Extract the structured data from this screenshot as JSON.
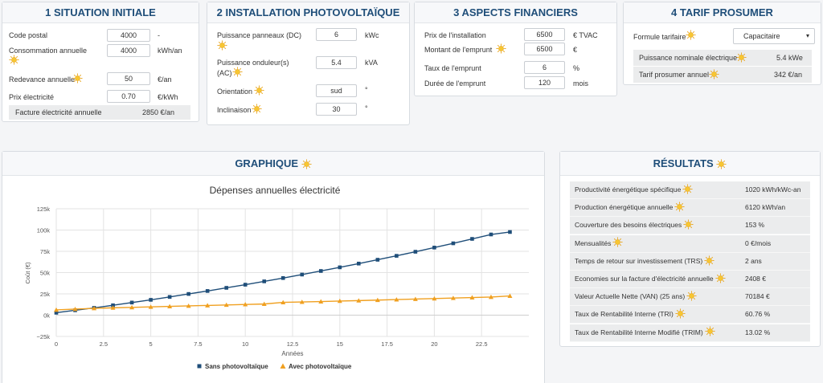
{
  "situation": {
    "title": "1 SITUATION INITIALE",
    "postal_label": "Code postal",
    "postal_value": "4000",
    "postal_unit": "-",
    "consumption_label": "Consommation annuelle",
    "consumption_value": "4000",
    "consumption_unit": "kWh/an",
    "fee_label": "Redevance annuelle",
    "fee_value": "50",
    "fee_unit": "€/an",
    "price_label": "Prix électricité",
    "price_value": "0.70",
    "price_unit": "€/kWh",
    "bill_label": "Facture électricité annuelle",
    "bill_value": "2850 €/an"
  },
  "installation": {
    "title": "2 INSTALLATION PHOTOVOLTAÏQUE",
    "panel_power_label": "Puissance panneaux (DC)",
    "panel_power_value": "6",
    "panel_power_unit": "kWc",
    "inverter_label_1": "Puissance onduleur(s)",
    "inverter_label_2": "(AC)",
    "inverter_value": "5.4",
    "inverter_unit": "kVA",
    "orientation_label": "Orientation",
    "orientation_value": "sud",
    "orientation_unit": "°",
    "tilt_label": "Inclinaison",
    "tilt_value": "30",
    "tilt_unit": "°"
  },
  "financial": {
    "title": "3 ASPECTS FINANCIERS",
    "install_price_label": "Prix de l'installation",
    "install_price_value": "6500",
    "install_price_unit": "€ TVAC",
    "loan_amount_label": "Montant de l'emprunt",
    "loan_amount_value": "6500",
    "loan_amount_unit": "€",
    "loan_rate_label": "Taux de l'emprunt",
    "loan_rate_value": "6",
    "loan_rate_unit": "%",
    "loan_duration_label": "Durée de l'emprunt",
    "loan_duration_value": "120",
    "loan_duration_unit": "mois"
  },
  "prosumer": {
    "title": "4 TARIF PROSUMER",
    "formula_label": "Formule tarifaire",
    "formula_value": "Capacitaire",
    "nominal_label": "Puissance nominale électrique",
    "nominal_value": "5.4 kWe",
    "tariff_label": "Tarif prosumer annuel",
    "tariff_value": "342 €/an"
  },
  "graph": {
    "panel_title": "GRAPHIQUE"
  },
  "chart_data": {
    "type": "line",
    "title": "Dépenses annuelles électricité",
    "xlabel": "Années",
    "ylabel": "Coût (€)",
    "xlim": [
      0,
      25
    ],
    "ylim": [
      -25000,
      125000
    ],
    "x_ticks": [
      "0",
      "2.5",
      "5",
      "7.5",
      "10",
      "12.5",
      "15",
      "17.5",
      "20",
      "22.5"
    ],
    "y_ticks": [
      "125k",
      "100k",
      "75k",
      "50k",
      "25k",
      "0k",
      "−25k"
    ],
    "grid": true,
    "legend": "bottom",
    "x": [
      0,
      1,
      2,
      3,
      4,
      5,
      6,
      7,
      8,
      9,
      10,
      11,
      12,
      13,
      14,
      15,
      16,
      17,
      18,
      19,
      20,
      21,
      22,
      23,
      24
    ],
    "series": [
      {
        "name": "Sans photovoltaïque",
        "color": "#1f4e79",
        "marker": "square",
        "values": [
          2850,
          5700,
          8600,
          11600,
          14800,
          18000,
          21400,
          24900,
          28400,
          32100,
          35800,
          39700,
          43600,
          47700,
          51900,
          56200,
          60600,
          65100,
          69700,
          74500,
          79400,
          84400,
          89600,
          94800,
          97700
        ]
      },
      {
        "name": "Avec photovoltaïque",
        "color": "#f0a020",
        "marker": "triangle",
        "values": [
          6200,
          7100,
          8000,
          8600,
          9100,
          9700,
          10300,
          10900,
          11400,
          12000,
          12600,
          13100,
          15000,
          15500,
          16000,
          16600,
          17100,
          17700,
          18300,
          18900,
          19500,
          20100,
          20700,
          21300,
          22600
        ]
      }
    ]
  },
  "results": {
    "title": "RÉSULTATS",
    "rows": [
      {
        "label": "Productivité énergétique spécifique",
        "value": "1020 kWh/kWc-an"
      },
      {
        "label": "Production énergétique annuelle",
        "value": "6120 kWh/an"
      },
      {
        "label": "Couverture des besoins électriques",
        "value": "153 %"
      },
      {
        "label": "Mensualités",
        "value": "0 €/mois"
      },
      {
        "label": "Temps de retour sur investissement (TRS)",
        "value": "2 ans"
      },
      {
        "label": "Economies sur la facture d'électricité annuelle",
        "value": "2408 €"
      },
      {
        "label": "Valeur Actuelle Nette (VAN) (25 ans)",
        "value": "70184 €"
      },
      {
        "label": "Taux de Rentabilité Interne (TRI)",
        "value": "60.76 %"
      },
      {
        "label": "Taux de Rentabilité Interne Modifié (TRIM)",
        "value": "13.02 %"
      }
    ]
  },
  "icons": {
    "help": "sun-help-icon",
    "dropdown": "chevron-down-icon"
  },
  "colors": {
    "heading": "#1f4e79",
    "series1": "#1f4e79",
    "series2": "#f0a020"
  }
}
